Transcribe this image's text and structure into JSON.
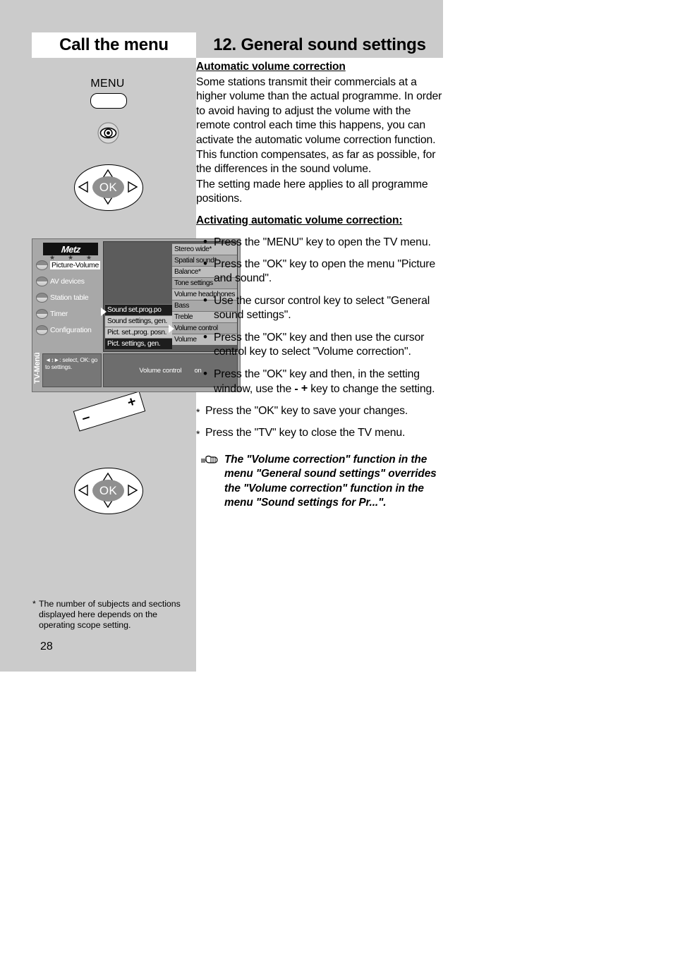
{
  "headers": {
    "left": "Call the menu",
    "right": "12. General sound settings"
  },
  "content": {
    "section_heading": "Automatic volume correction",
    "paragraphs": [
      "Some stations transmit their commercials at a higher volume than the actual programme. In order to avoid having to adjust the volume with the remote control each time this happens, you can activate the automatic volume correction function.",
      "This function compensates, as far as possible, for the differences in the sound volume.",
      "The setting made here applies to all programme positions."
    ],
    "activating_heading": "Activating automatic volume correction:",
    "steps": [
      "Press the \"MENU\" key to open the TV menu.",
      "Press the \"OK\" key to open the menu \"Picture and sound\".",
      "Use the cursor control key to select \"General sound settings\".",
      "Press the \"OK\" key and then use the cursor control key to select \"Volume correction\"."
    ],
    "step_last_a": "Press the \"OK\" key and then, in the setting window, use the",
    "step_last_minus": "-",
    "step_last_plus": "+",
    "step_last_b": "key to change the setting.",
    "star_lines": [
      "Press the \"OK\" key to save your changes.",
      "Press the \"TV\" key to close the TV menu."
    ],
    "note": "The \"Volume correction\" function in the menu \"General sound settings\" overrides the \"Volume correction\" function in the menu \"Sound settings for Pr...\"."
  },
  "remote": {
    "menu_label": "MENU",
    "ok_label": "OK",
    "minus_label": "–",
    "plus_label": "+"
  },
  "tvmenu": {
    "logo_text": "Metz",
    "stars": "★ ★ ★",
    "sidebar_items": [
      "Picture-Volume",
      "AV devices",
      "Station table",
      "Timer",
      "Configuration"
    ],
    "selected_sidebar": "Picture-Volume",
    "vertical_label": "TV-Menü",
    "help_text": "◄↕►: select, OK: go to settings.",
    "middle_column": [
      "Sound set.prog.po",
      "Sound settings, gen.",
      "Pict. set.,prog. posn.",
      "Pict. settings, gen."
    ],
    "middle_selected": "Sound settings, gen.",
    "right_column": [
      "Stereo wide*",
      "Spatial sound*",
      "Balance*",
      "Tone settings",
      "Volume headphones",
      "Bass",
      "Treble",
      "Volume control",
      "Volume"
    ],
    "right_selected": "Volume control",
    "status_label": "Volume control",
    "status_value": "on"
  },
  "footer": {
    "footnote_star": "*",
    "footnote": "The number of subjects and sections displayed here depends on the operating scope setting.",
    "page_number": "28"
  },
  "colors": {
    "page_grey": "#cbcbcb",
    "menu_bg": "#a8a8a8",
    "panel_bg": "#5c5c5c",
    "row_dark": "#1d1d1d",
    "highlight": "#ffffff"
  }
}
